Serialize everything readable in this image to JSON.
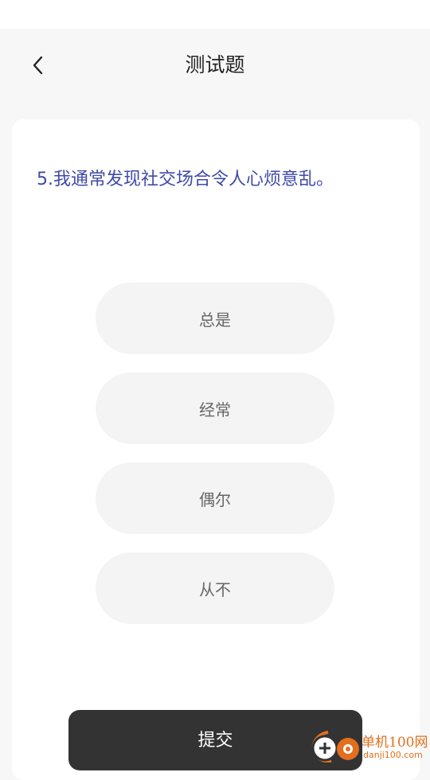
{
  "header": {
    "title": "测试题"
  },
  "question": {
    "text": "5.我通常发现社交场合令人心烦意乱。"
  },
  "options": [
    {
      "label": "总是"
    },
    {
      "label": "经常"
    },
    {
      "label": "偶尔"
    },
    {
      "label": "从不"
    }
  ],
  "submit": {
    "label": "提交"
  },
  "watermark": {
    "name": "单机100网",
    "domain": "danji100.com"
  },
  "colors": {
    "question_text": "#3f4aa8",
    "submit_bg": "#333333",
    "option_bg": "#f4f4f4",
    "watermark": "#e36f1e"
  },
  "icons": {
    "back": "chevron-left-icon"
  }
}
